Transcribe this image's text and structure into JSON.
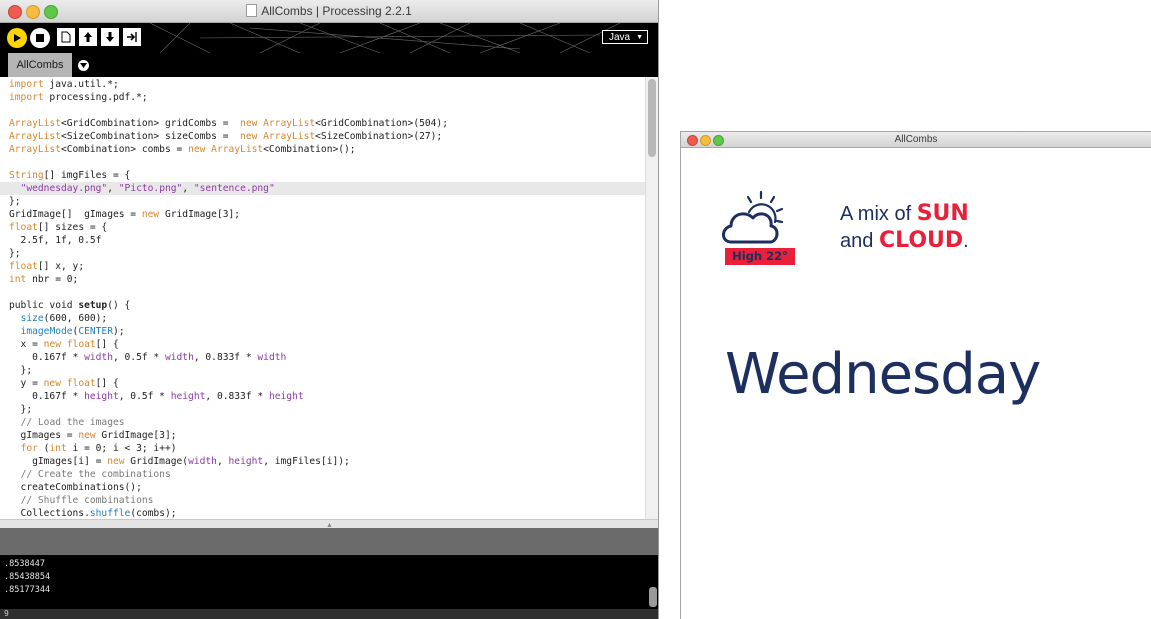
{
  "ide": {
    "window_title": "AllCombs | Processing 2.2.1",
    "mode": "Java",
    "tab_label": "AllCombs",
    "code_lines": [
      "import java.util.*;",
      "import processing.pdf.*;",
      "",
      "ArrayList<GridCombination> gridCombs =  new ArrayList<GridCombination>(504);",
      "ArrayList<SizeCombination> sizeCombs =  new ArrayList<SizeCombination>(27);",
      "ArrayList<Combination> combs = new ArrayList<Combination>();",
      "",
      "String[] imgFiles = {",
      "  \"wednesday.png\", \"Picto.png\", \"sentence.png\"",
      "};",
      "GridImage[]  gImages = new GridImage[3];",
      "float[] sizes = {",
      "  2.5f, 1f, 0.5f",
      "};",
      "float[] x, y;",
      "int nbr = 0;",
      "",
      "public void setup() {",
      "  size(600, 600);",
      "  imageMode(CENTER);",
      "  x = new float[] {",
      "    0.167f * width, 0.5f * width, 0.833f * width",
      "  };",
      "  y = new float[] {",
      "    0.167f * height, 0.5f * height, 0.833f * height",
      "  };",
      "  // Load the images",
      "  gImages = new GridImage[3];",
      "  for (int i = 0; i < 3; i++)",
      "    gImages[i] = new GridImage(width, height, imgFiles[i]);",
      "  // Create the combinations",
      "  createCombinations();",
      "  // Shuffle combinations",
      "  Collections.shuffle(combs);"
    ],
    "console_lines": [
      ".8538447",
      ".85438854",
      ".85177344"
    ],
    "status_line": "9"
  },
  "sketch": {
    "window_title": "AllCombs",
    "badge_text": "High 22°",
    "mix_line1_prefix": "A mix of ",
    "mix_line1_bold": "SUN",
    "mix_line2_prefix": "and ",
    "mix_line2_bold": "CLOUD",
    "mix_line2_suffix": ".",
    "day_text": "Wednesday"
  },
  "icons": {
    "run": "run-icon",
    "stop": "stop-icon",
    "new": "new-file-icon",
    "open": "open-icon",
    "save": "save-icon",
    "export": "export-icon",
    "weather": "partly-cloudy-icon"
  },
  "colors": {
    "run_button": "#ffd400",
    "brand_navy": "#1c2f5f",
    "brand_red": "#e8203a",
    "syntax_keyword": "#d4872f",
    "syntax_function": "#1e7fbe",
    "syntax_string": "#8e3ba6"
  }
}
